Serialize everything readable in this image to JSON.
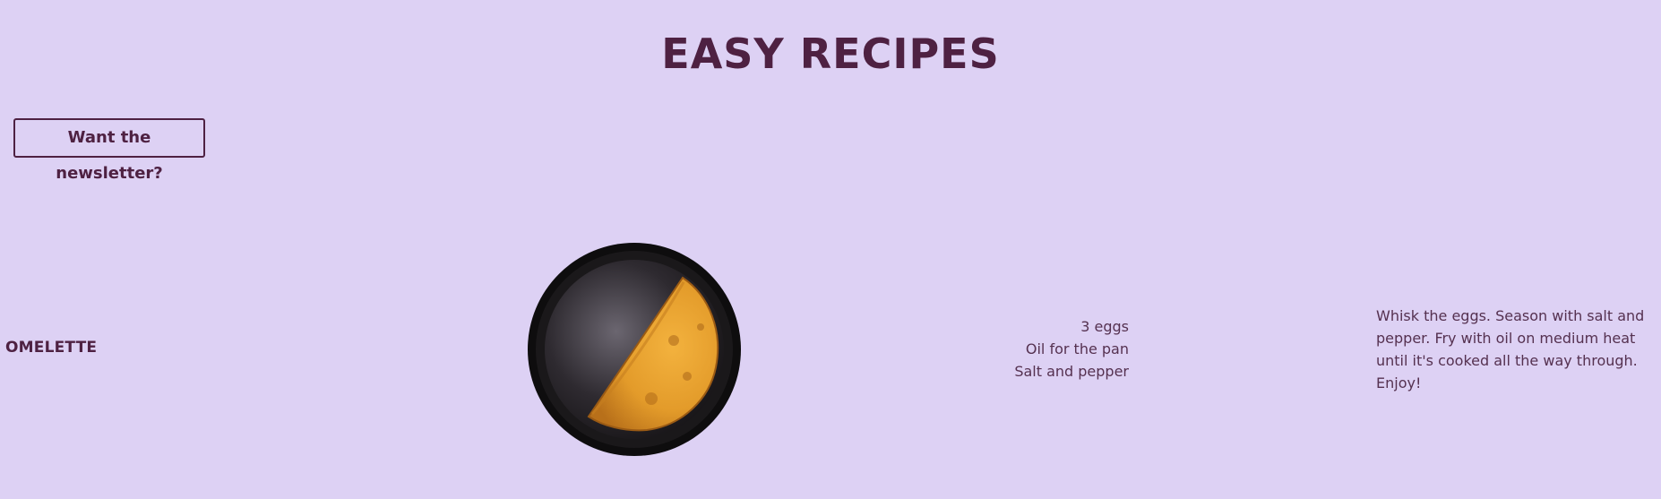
{
  "header": {
    "title": "EASY RECIPES"
  },
  "newsletter": {
    "label": "Want the newsletter?"
  },
  "recipes": [
    {
      "name": "OMELETTE",
      "ingredients": [
        "3 eggs",
        "Oil for the pan",
        "Salt and pepper"
      ],
      "instructions": "Whisk the eggs. Season with salt and pepper. Fry with oil on medium heat until it's cooked all the way through. Enjoy!",
      "image": "omelette-in-pan"
    }
  ],
  "colors": {
    "background": "#ddd1f4",
    "accent": "#4e2142",
    "text": "#553150"
  }
}
